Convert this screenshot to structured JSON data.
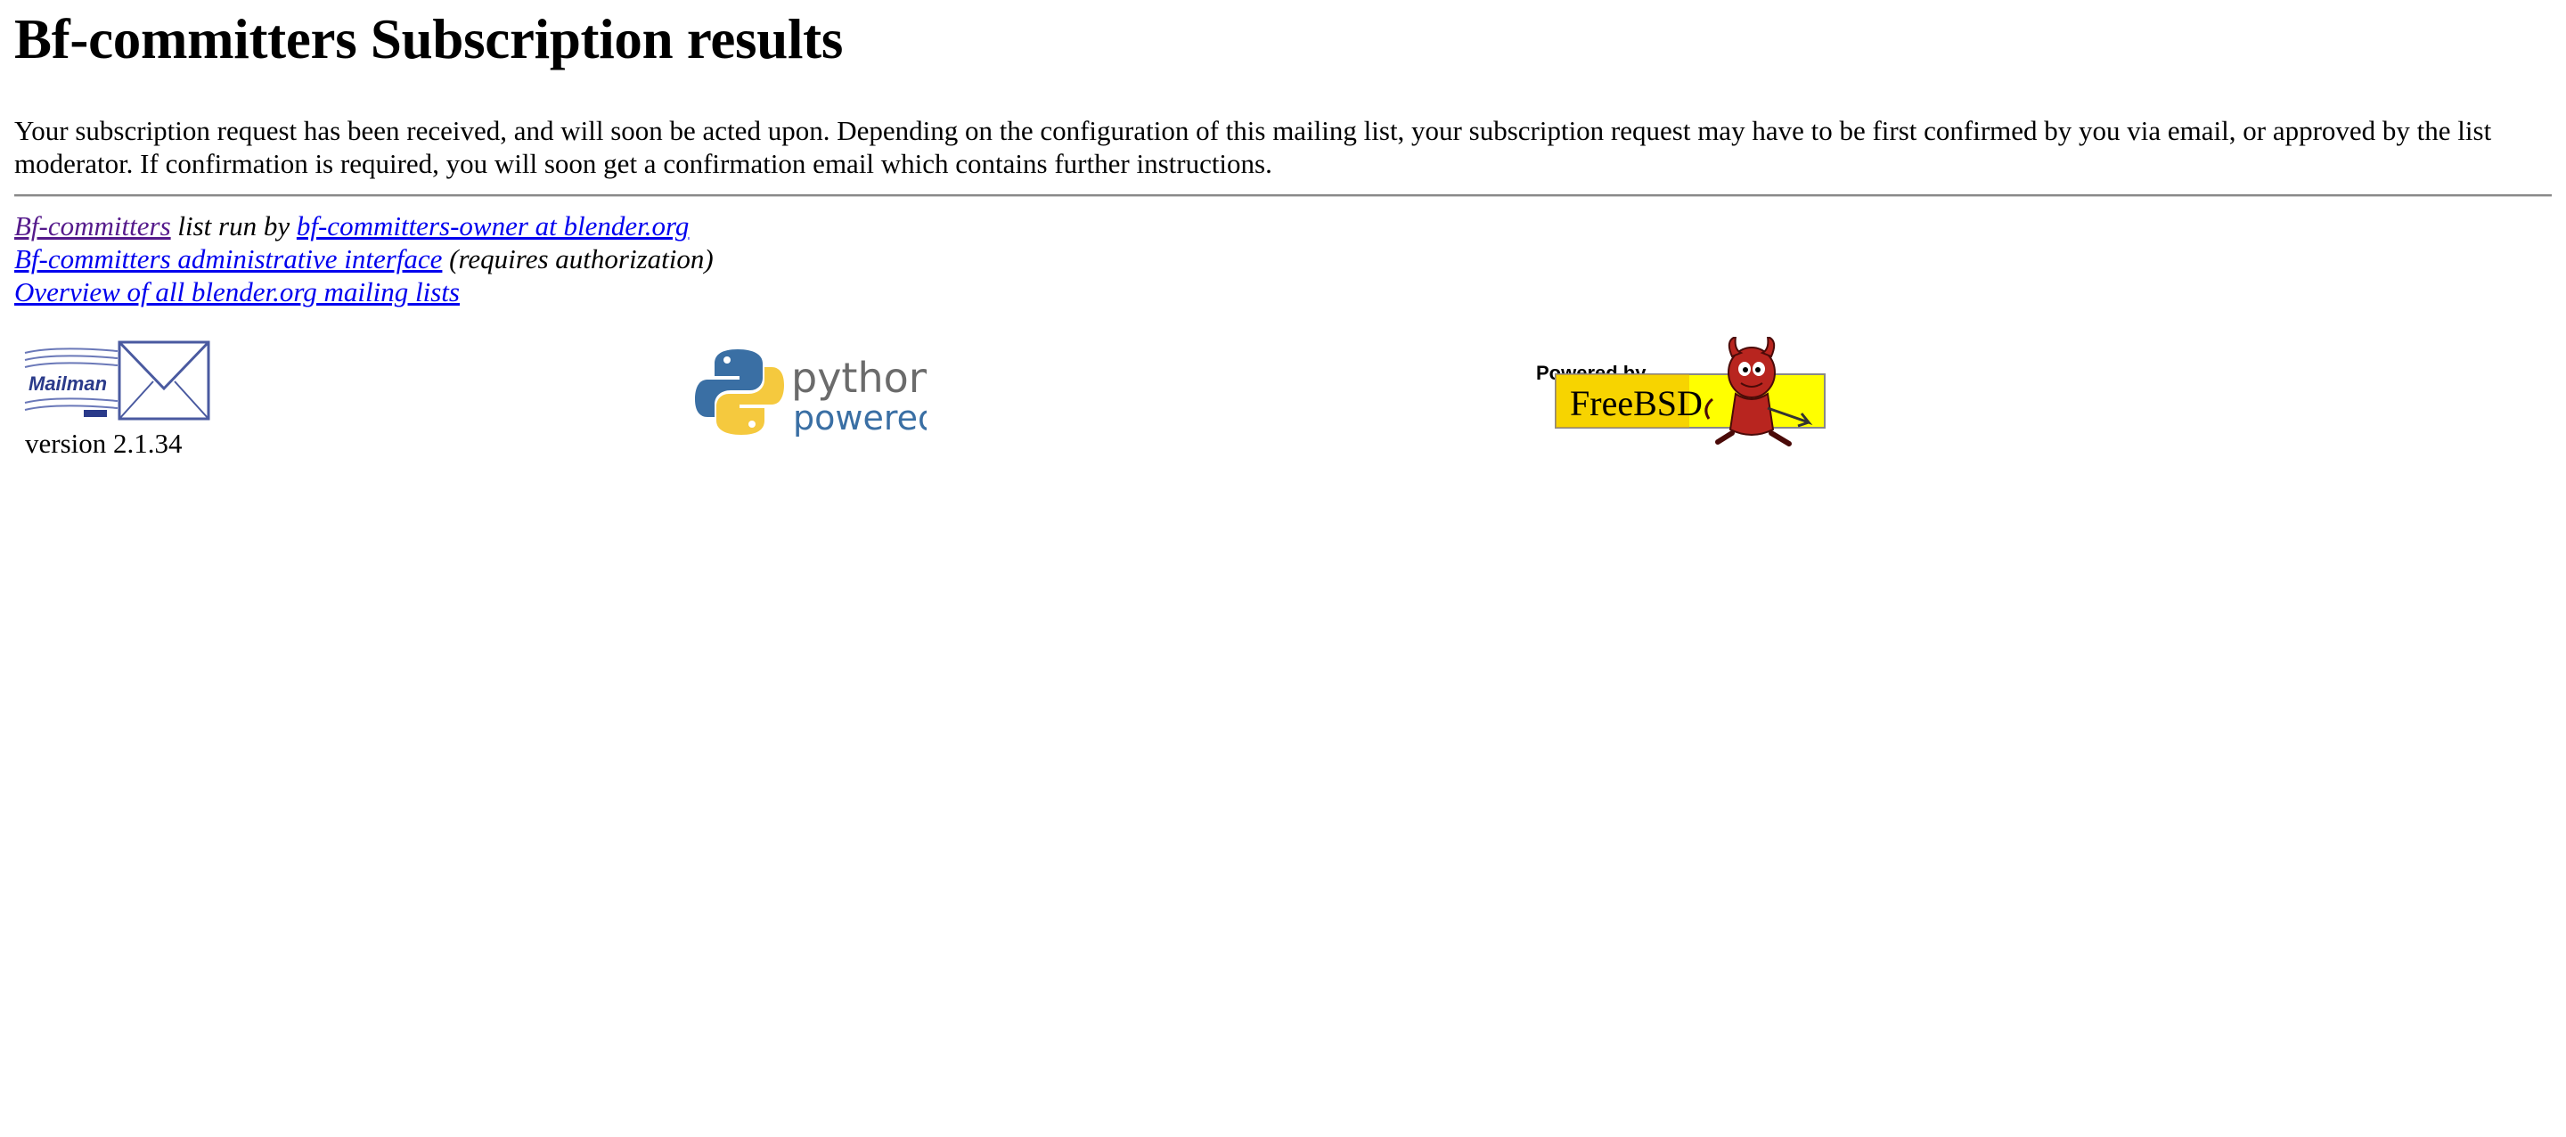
{
  "page": {
    "title": "Bf-committers Subscription results",
    "intro": "Your subscription request has been received, and will soon be acted upon. Depending on the configuration of this mailing list, your subscription request may have to be first confirmed by you via email, or approved by the list moderator. If confirmation is required, you will soon get a confirmation email which contains further instructions."
  },
  "footer": {
    "list_link": "Bf-committers",
    "list_run_by": " list run by ",
    "owner_link": "bf-committers-owner at blender.org",
    "admin_link": "Bf-committers administrative interface",
    "admin_note": " (requires authorization)",
    "overview_link": "Overview of all blender.org mailing lists"
  },
  "logos": {
    "mailman": {
      "icon": "mailman-logo",
      "text": "Mailman",
      "version": "version 2.1.34"
    },
    "python": {
      "icon": "python-powered-logo",
      "word1": "python",
      "word2": "powered"
    },
    "freebsd": {
      "icon": "freebsd-powered-logo",
      "caption": "Powered by...",
      "text": "FreeBSD"
    }
  },
  "colors": {
    "link": "#0000ee",
    "visited": "#551a8b",
    "python_blue": "#3a6fa4",
    "python_yellow": "#f5c93e",
    "freebsd_yellow": "#ffff00",
    "freebsd_red": "#b8251f"
  }
}
